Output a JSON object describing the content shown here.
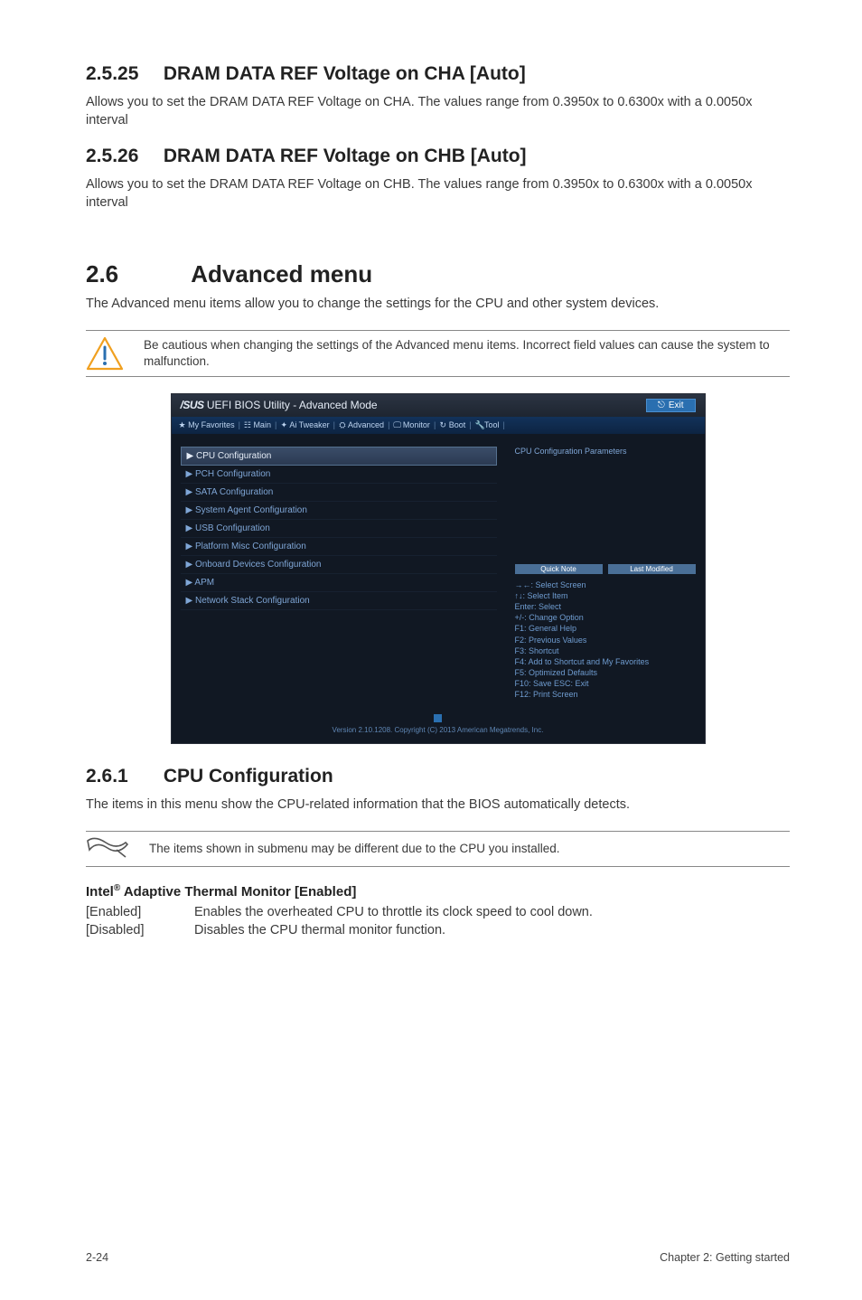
{
  "s2525": {
    "heading_num": "2.5.25",
    "heading_text": "DRAM DATA REF Voltage on CHA [Auto]",
    "body": "Allows you to set the DRAM DATA REF Voltage on CHA. The values range from 0.3950x to 0.6300x with a 0.0050x interval"
  },
  "s2526": {
    "heading_num": "2.5.26",
    "heading_text": "DRAM DATA REF Voltage on CHB [Auto]",
    "body": "Allows you to set the DRAM DATA REF Voltage on CHB. The values range from 0.3950x to 0.6300x with a 0.0050x interval"
  },
  "s26": {
    "heading_num": "2.6",
    "heading_text": "Advanced menu",
    "body": "The Advanced menu items allow you to change the settings for the CPU and other system devices.",
    "warn": "Be cautious when changing the settings of the Advanced menu items. Incorrect field values can cause the system to malfunction."
  },
  "bios": {
    "title_left": "UEFI BIOS Utility - Advanced Mode",
    "title_brand": "/SUS",
    "exit": "Exit",
    "tabs": {
      "fav": "★ My Favorites",
      "main": "Main",
      "ai": "Ai Tweaker",
      "adv": "Advanced",
      "mon": "Monitor",
      "boot": "Boot",
      "tool": "Tool"
    },
    "left_items": [
      "CPU Configuration",
      "PCH Configuration",
      "SATA Configuration",
      "System Agent Configuration",
      "USB Configuration",
      "Platform Misc Configuration",
      "Onboard Devices Configuration",
      "APM",
      "Network Stack Configuration"
    ],
    "right_desc": "CPU Configuration Parameters",
    "btn_quick": "Quick Note",
    "btn_last": "Last Modified",
    "help_lines": [
      "→←: Select Screen",
      "↑↓: Select Item",
      "Enter: Select",
      "+/-: Change Option",
      "F1: General Help",
      "F2: Previous Values",
      "F3: Shortcut",
      "F4: Add to Shortcut and My Favorites",
      "F5: Optimized Defaults",
      "F10: Save  ESC: Exit",
      "F12: Print Screen"
    ],
    "foot": "Version 2.10.1208. Copyright (C) 2013 American Megatrends, Inc."
  },
  "s261": {
    "heading_num": "2.6.1",
    "heading_text": "CPU Configuration",
    "body": "The items in this menu show the CPU-related information that the BIOS automatically detects.",
    "note": "The items shown in submenu may be different due to the CPU you installed."
  },
  "intel": {
    "heading": "Intel® Adaptive Thermal Monitor [Enabled]",
    "heading_plain_prefix": "Intel",
    "heading_plain_suffix": " Adaptive Thermal Monitor [Enabled]",
    "rows": [
      {
        "k": "[Enabled]",
        "v": "Enables the overheated CPU to throttle its clock speed to cool down."
      },
      {
        "k": "[Disabled]",
        "v": "Disables the CPU thermal monitor function."
      }
    ]
  },
  "footer": {
    "left": "2-24",
    "right": "Chapter 2: Getting started"
  }
}
